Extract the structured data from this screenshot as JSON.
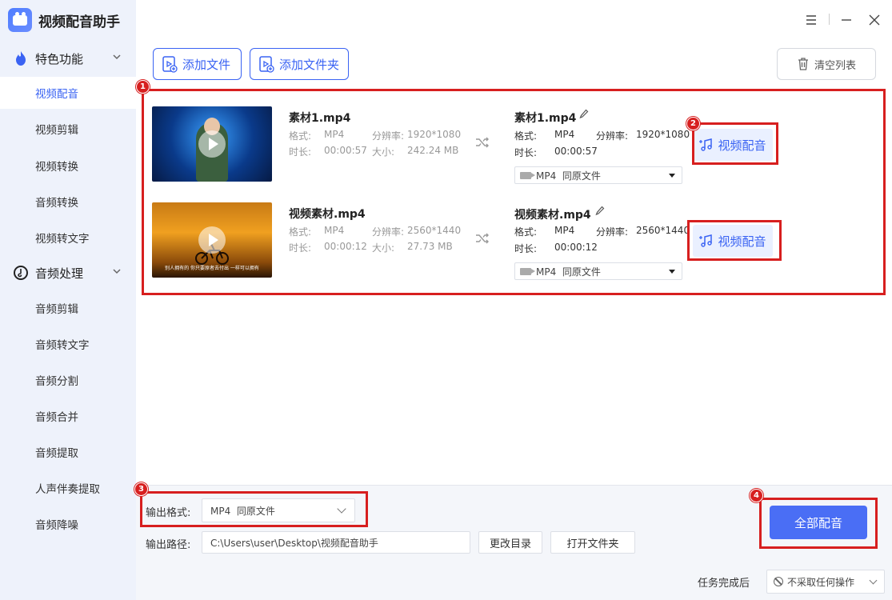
{
  "app": {
    "name": "视频配音助手"
  },
  "sidebar": {
    "groups": [
      {
        "label": "特色功能",
        "items": [
          "视频配音",
          "视频剪辑",
          "视频转换",
          "音频转换",
          "视频转文字"
        ]
      },
      {
        "label": "音频处理",
        "items": [
          "音频剪辑",
          "音频转文字",
          "音频分割",
          "音频合并",
          "音频提取",
          "人声伴奏提取",
          "音频降噪"
        ]
      }
    ],
    "active_item": "视频配音"
  },
  "toolbar": {
    "add_file": "添加文件",
    "add_folder": "添加文件夹",
    "clear_list": "清空列表"
  },
  "files": [
    {
      "name": "素材1.mp4",
      "format_label": "格式:",
      "format": "MP4",
      "resolution_label": "分辨率:",
      "resolution": "1920*1080",
      "duration_label": "时长:",
      "duration": "00:00:57",
      "size_label": "大小:",
      "size": "242.24 MB",
      "out_name": "素材1.mp4",
      "out_format": "MP4",
      "out_resolution": "1920*1080",
      "out_duration": "00:00:57",
      "out_select": "MP4  同原文件",
      "dub_label": "视频配音"
    },
    {
      "name": "视频素材.mp4",
      "format_label": "格式:",
      "format": "MP4",
      "resolution_label": "分辨率:",
      "resolution": "2560*1440",
      "duration_label": "时长:",
      "duration": "00:00:12",
      "size_label": "大小:",
      "size": "27.73 MB",
      "out_name": "视频素材.mp4",
      "out_format": "MP4",
      "out_resolution": "2560*1440",
      "out_duration": "00:00:12",
      "out_select": "MP4  同原文件",
      "dub_label": "视频配音",
      "thumb_subtitle": "别人拥有的 你只要原者去付出 一样可以拥有"
    }
  ],
  "bottom": {
    "format_label": "输出格式:",
    "format_value": "MP4  同原文件",
    "path_label": "输出路径:",
    "path_value": "C:\\Users\\user\\Desktop\\视频配音助手",
    "change_dir": "更改目录",
    "open_folder": "打开文件夹",
    "dub_all": "全部配音",
    "after_label": "任务完成后",
    "after_value": "不采取任何操作"
  },
  "annotations": [
    "1",
    "2",
    "3",
    "4"
  ],
  "colors": {
    "accent": "#3a63f3",
    "primary_button": "#4a6ef5",
    "highlight": "#d71f1f",
    "sidebar_bg": "#eef2fb"
  }
}
